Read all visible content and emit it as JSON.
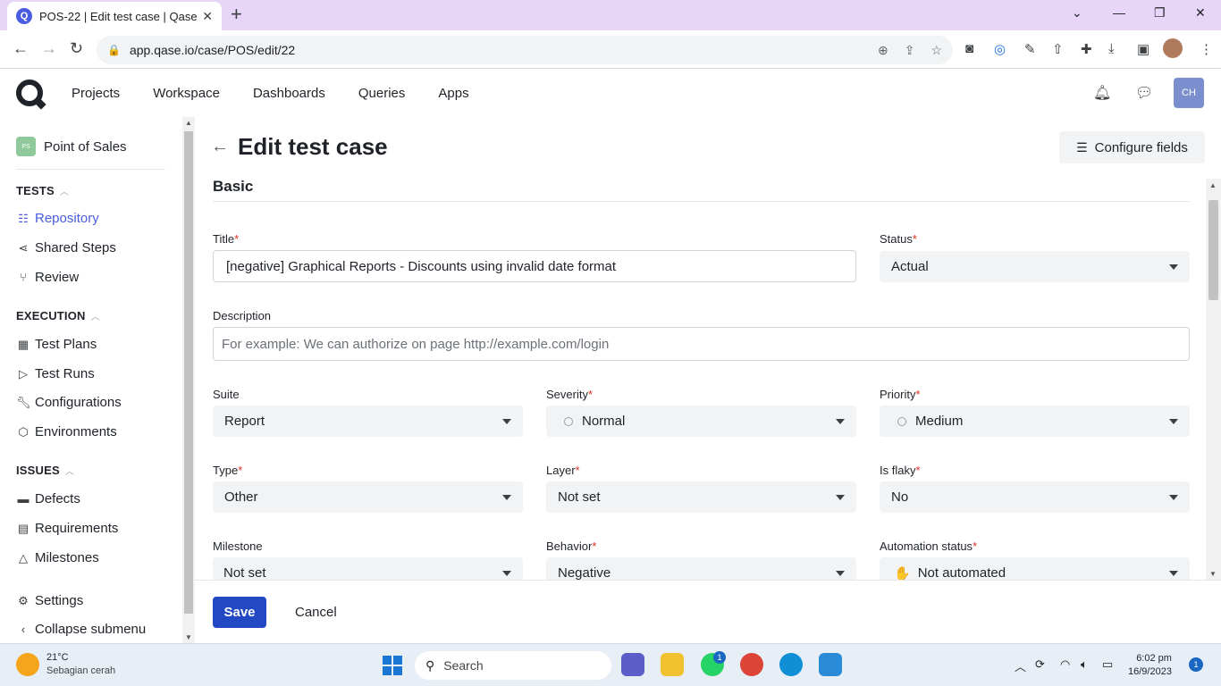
{
  "browser": {
    "tab_title": "POS-22 | Edit test case | Qase",
    "tab_favicon": "Q",
    "url": "app.qase.io/case/POS/edit/22",
    "accent": "#e7d6f7"
  },
  "header": {
    "nav": [
      "Projects",
      "Workspace",
      "Dashboards",
      "Queries",
      "Apps"
    ],
    "avatar_initials": "CH"
  },
  "sidebar": {
    "project_badge": "PS",
    "project_name": "Point of Sales",
    "sections": {
      "tests": "TESTS",
      "execution": "EXECUTION",
      "issues": "ISSUES"
    },
    "items": {
      "repository": "Repository",
      "shared_steps": "Shared Steps",
      "review": "Review",
      "test_plans": "Test Plans",
      "test_runs": "Test Runs",
      "configurations": "Configurations",
      "environments": "Environments",
      "defects": "Defects",
      "requirements": "Requirements",
      "milestones": "Milestones",
      "settings": "Settings",
      "collapse": "Collapse submenu"
    }
  },
  "page": {
    "title": "Edit test case",
    "configure_fields": "Configure fields",
    "section": "Basic"
  },
  "form": {
    "title": {
      "label": "Title",
      "value": "[negative] Graphical Reports - Discounts using invalid date format"
    },
    "status": {
      "label": "Status",
      "value": "Actual"
    },
    "description": {
      "label": "Description",
      "placeholder": "For example: We can authorize on page http://example.com/login"
    },
    "suite": {
      "label": "Suite",
      "value": "Report"
    },
    "severity": {
      "label": "Severity",
      "value": "Normal"
    },
    "priority": {
      "label": "Priority",
      "value": "Medium"
    },
    "type": {
      "label": "Type",
      "value": "Other"
    },
    "layer": {
      "label": "Layer",
      "value": "Not set"
    },
    "is_flaky": {
      "label": "Is flaky",
      "value": "No"
    },
    "milestone": {
      "label": "Milestone",
      "value": "Not set"
    },
    "behavior": {
      "label": "Behavior",
      "value": "Negative"
    },
    "automation_status": {
      "label": "Automation status",
      "value": "Not automated"
    },
    "required_mark": "*"
  },
  "actions": {
    "save": "Save",
    "cancel": "Cancel"
  },
  "taskbar": {
    "temperature": "21°C",
    "weather": "Sebagian cerah",
    "search": "Search",
    "whatsapp_badge": "1",
    "time": "6:02 pm",
    "date": "16/9/2023",
    "notifications": "1"
  }
}
